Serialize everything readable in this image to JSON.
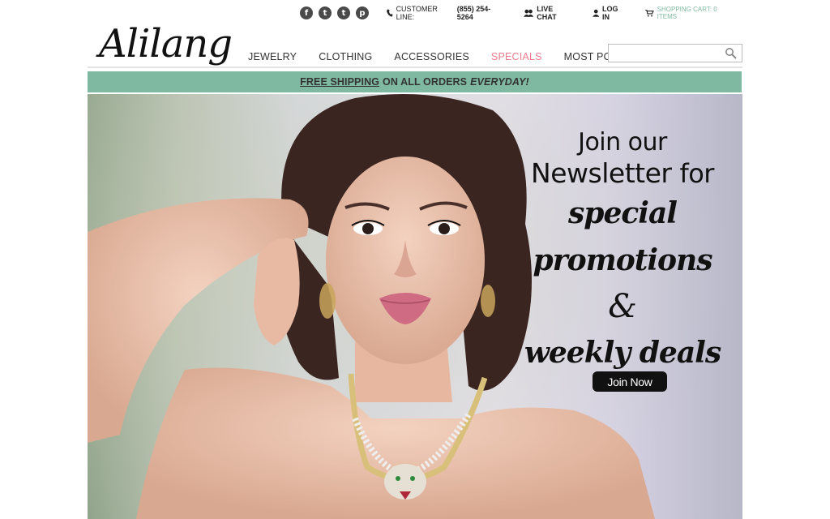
{
  "topbar": {
    "social": [
      {
        "name": "facebook-icon",
        "glyph": "f"
      },
      {
        "name": "twitter-icon",
        "glyph": "t"
      },
      {
        "name": "tumblr-icon",
        "glyph": "t"
      },
      {
        "name": "pinterest-icon",
        "glyph": "p"
      }
    ],
    "customer_line_label": "CUSTOMER LINE:",
    "customer_line_number": "(855) 254-5264",
    "live_chat": "LIVE CHAT",
    "log_in": "LOG IN",
    "cart": "SHOPPING CART: 0 ITEMS"
  },
  "header": {
    "logo": "Alilang",
    "nav": [
      "JEWELRY",
      "CLOTHING",
      "ACCESSORIES",
      "SPECIALS",
      "MOST POPULAR"
    ],
    "search_placeholder": ""
  },
  "shipping": {
    "free": "FREE SHIPPING",
    "rest": "ON ALL ORDERS",
    "every": "EVERYDAY!"
  },
  "hero": {
    "line1": "Join our",
    "line2": "Newsletter",
    "line2b": "for",
    "line3": "special promotions",
    "line4": "&",
    "line5": "weekly deals",
    "button": "Join Now"
  },
  "colors": {
    "accent_green": "#7fb9a2",
    "specials_pink": "#ee7e8e"
  }
}
